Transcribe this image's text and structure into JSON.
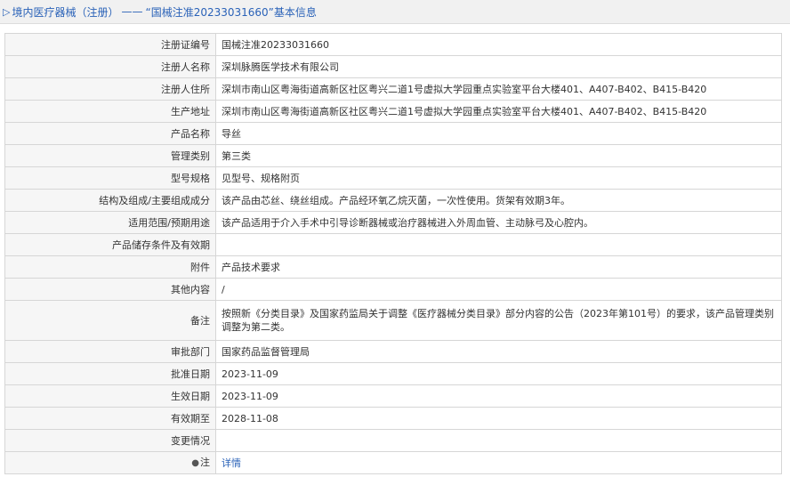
{
  "header": {
    "arrow": "▷",
    "category": "境内医疗器械（注册）",
    "separator": "——",
    "record_title": "“国械注准20233031660”基本信息"
  },
  "rows": [
    {
      "label": "注册证编号",
      "value": "国械注准20233031660"
    },
    {
      "label": "注册人名称",
      "value": "深圳脉腾医学技术有限公司"
    },
    {
      "label": "注册人住所",
      "value": "深圳市南山区粤海街道高新区社区粤兴二道1号虚拟大学园重点实验室平台大楼401、A407-B402、B415-B420"
    },
    {
      "label": "生产地址",
      "value": "深圳市南山区粤海街道高新区社区粤兴二道1号虚拟大学园重点实验室平台大楼401、A407-B402、B415-B420"
    },
    {
      "label": "产品名称",
      "value": "导丝"
    },
    {
      "label": "管理类别",
      "value": "第三类"
    },
    {
      "label": "型号规格",
      "value": "见型号、规格附页"
    },
    {
      "label": "结构及组成/主要组成成分",
      "value": "该产品由芯丝、绕丝组成。产品经环氧乙烷灭菌，一次性使用。货架有效期3年。"
    },
    {
      "label": "适用范围/预期用途",
      "value": "该产品适用于介入手术中引导诊断器械或治疗器械进入外周血管、主动脉弓及心腔内。"
    },
    {
      "label": "产品储存条件及有效期",
      "value": ""
    },
    {
      "label": "附件",
      "value": "产品技术要求"
    },
    {
      "label": "其他内容",
      "value": "/"
    },
    {
      "label": "备注",
      "value": "按照新《分类目录》及国家药监局关于调整《医疗器械分类目录》部分内容的公告（2023年第101号）的要求，该产品管理类别调整为第二类。"
    },
    {
      "label": "审批部门",
      "value": "国家药品监督管理局"
    },
    {
      "label": "批准日期",
      "value": "2023-11-09"
    },
    {
      "label": "生效日期",
      "value": "2023-11-09"
    },
    {
      "label": "有效期至",
      "value": "2028-11-08"
    },
    {
      "label": "变更情况",
      "value": ""
    },
    {
      "label": "注",
      "value": "详情"
    }
  ],
  "icons": {
    "note_icon": "pin-icon"
  },
  "colors": {
    "link": "#2a62b8",
    "label_bg": "#f6f6f6",
    "border": "#d6d6d6"
  }
}
